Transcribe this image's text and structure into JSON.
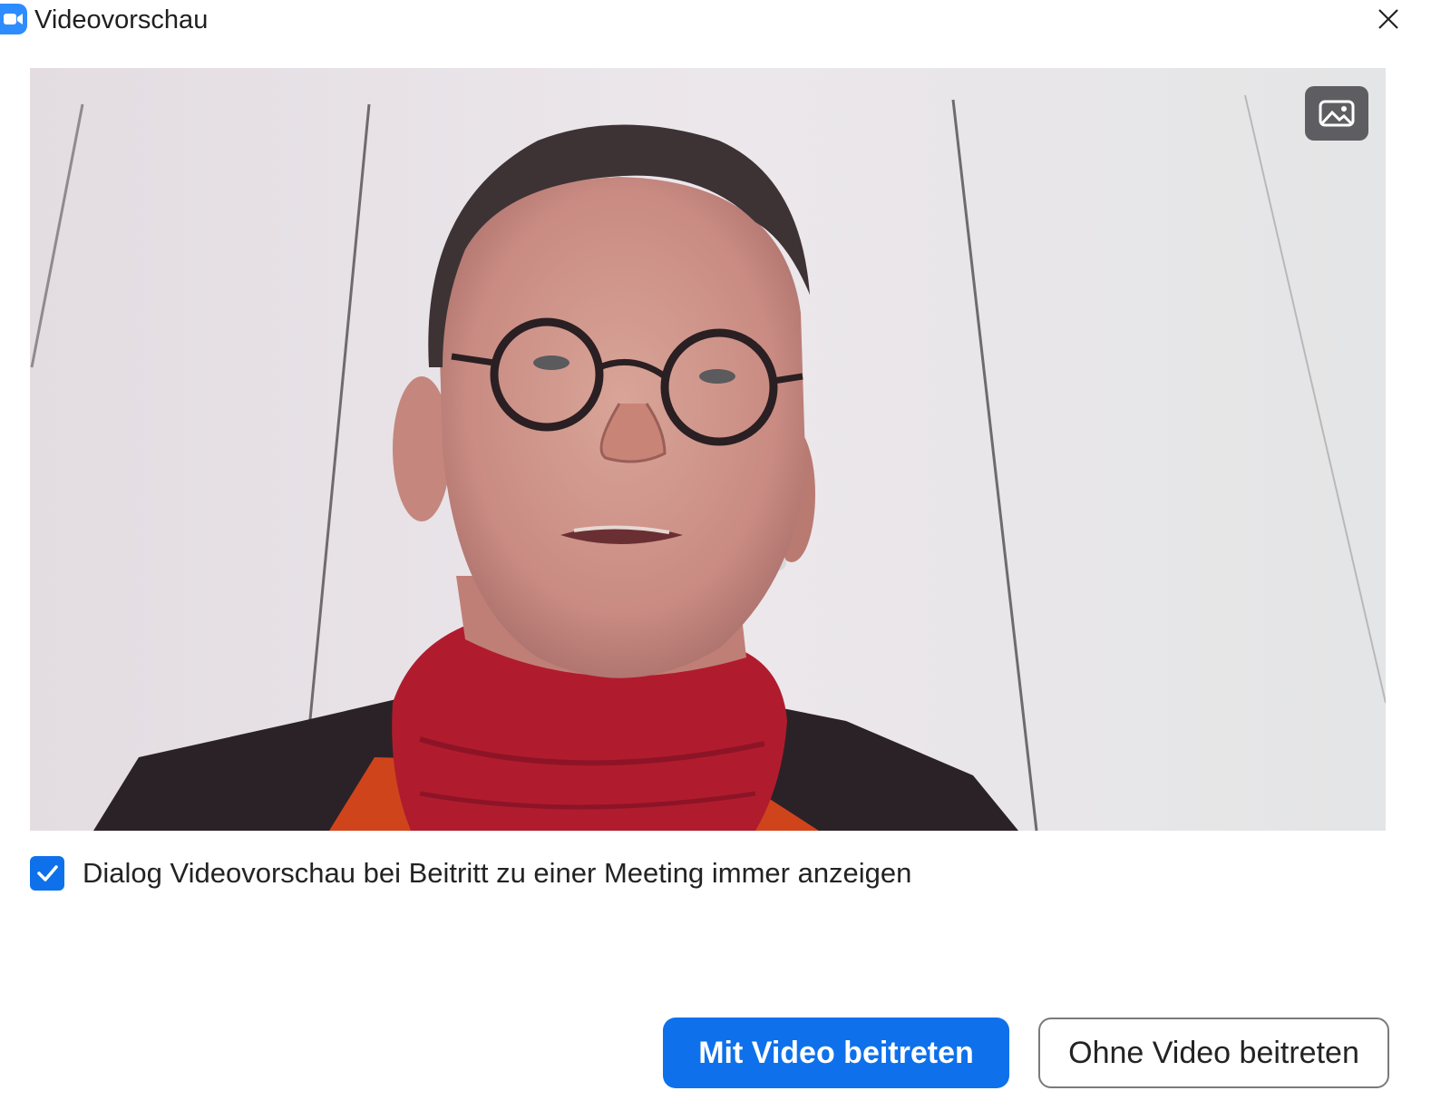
{
  "window": {
    "title": "Videovorschau",
    "app_icon": "zoom-video-icon",
    "close_icon": "close-icon"
  },
  "preview": {
    "background_button_icon": "image-background-icon"
  },
  "option": {
    "checked": true,
    "label": "Dialog Videovorschau bei Beitritt zu einer Meeting immer anzeigen"
  },
  "actions": {
    "join_with_video": "Mit Video beitreten",
    "join_without_video": "Ohne Video beitreten"
  },
  "colors": {
    "accent": "#0E71EB",
    "app_icon": "#2D8CFF"
  }
}
